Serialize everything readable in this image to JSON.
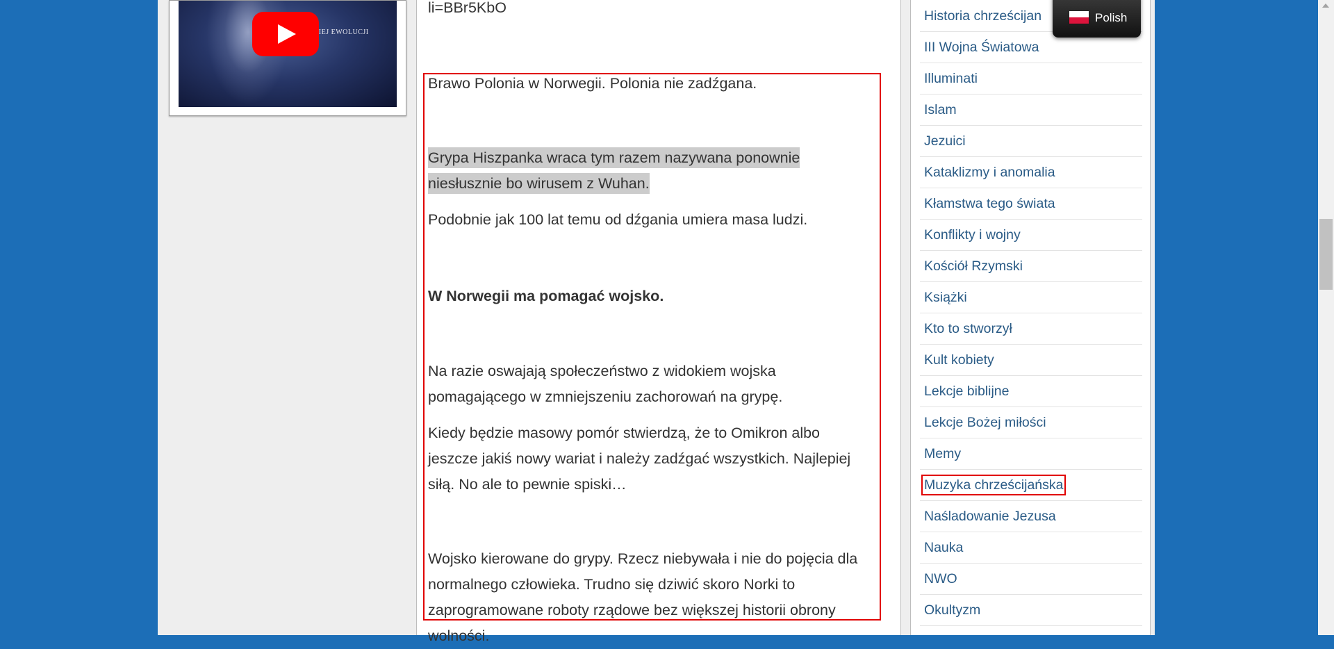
{
  "video": {
    "caption": "UDZKIEJ EWOLUCJI"
  },
  "article": {
    "link_tail": "li=BBr5KbO",
    "paragraphs": [
      "Brawo Polonia w Norwegii. Polonia nie zadźgana.",
      "Grypa Hiszpanka wraca tym razem nazywana ponownie niesłusznie  bo wirusem z Wuhan.",
      "Podobnie jak 100 lat temu od dźgania umiera masa ludzi.",
      "W Norwegii ma pomagać wojsko.",
      "Na razie oswajają społeczeństwo z widokiem wojska pomagającego w zmniejszeniu zachorowań na grypę.",
      "Kiedy będzie masowy pomór stwierdzą, że to Omikron albo jeszcze jakiś nowy wariat i należy zadźgać wszystkich. Najlepiej siłą. No ale to pewnie spiski…",
      "Wojsko kierowane do grypy. Rzecz niebywała i nie do pojęcia dla normalnego człowieka. Trudno się dziwić skoro Norki to zaprogramowane roboty rządowe bez większej historii obrony wolności."
    ]
  },
  "sidebar": {
    "categories": [
      "Historia chrześcijan",
      "III Wojna Światowa",
      "Illuminati",
      "Islam",
      "Jezuici",
      "Kataklizmy i anomalia",
      "Kłamstwa tego świata",
      "Konflikty i wojny",
      "Kościół Rzymski",
      "Książki",
      "Kto to stworzył",
      "Kult kobiety",
      "Lekcje biblijne",
      "Lekcje Bożej miłości",
      "Memy",
      "Muzyka chrześcijańska",
      "Naśladowanie Jezusa",
      "Nauka",
      "NWO",
      "Okultyzm"
    ]
  },
  "language": {
    "label": "Polish",
    "flag_colors": [
      "#ffffff",
      "#dc143c"
    ]
  },
  "colors": {
    "background": "#1c6eb7",
    "link": "#2a5b86",
    "highlight_border": "#e10000",
    "youtube_red": "#ff0000"
  }
}
